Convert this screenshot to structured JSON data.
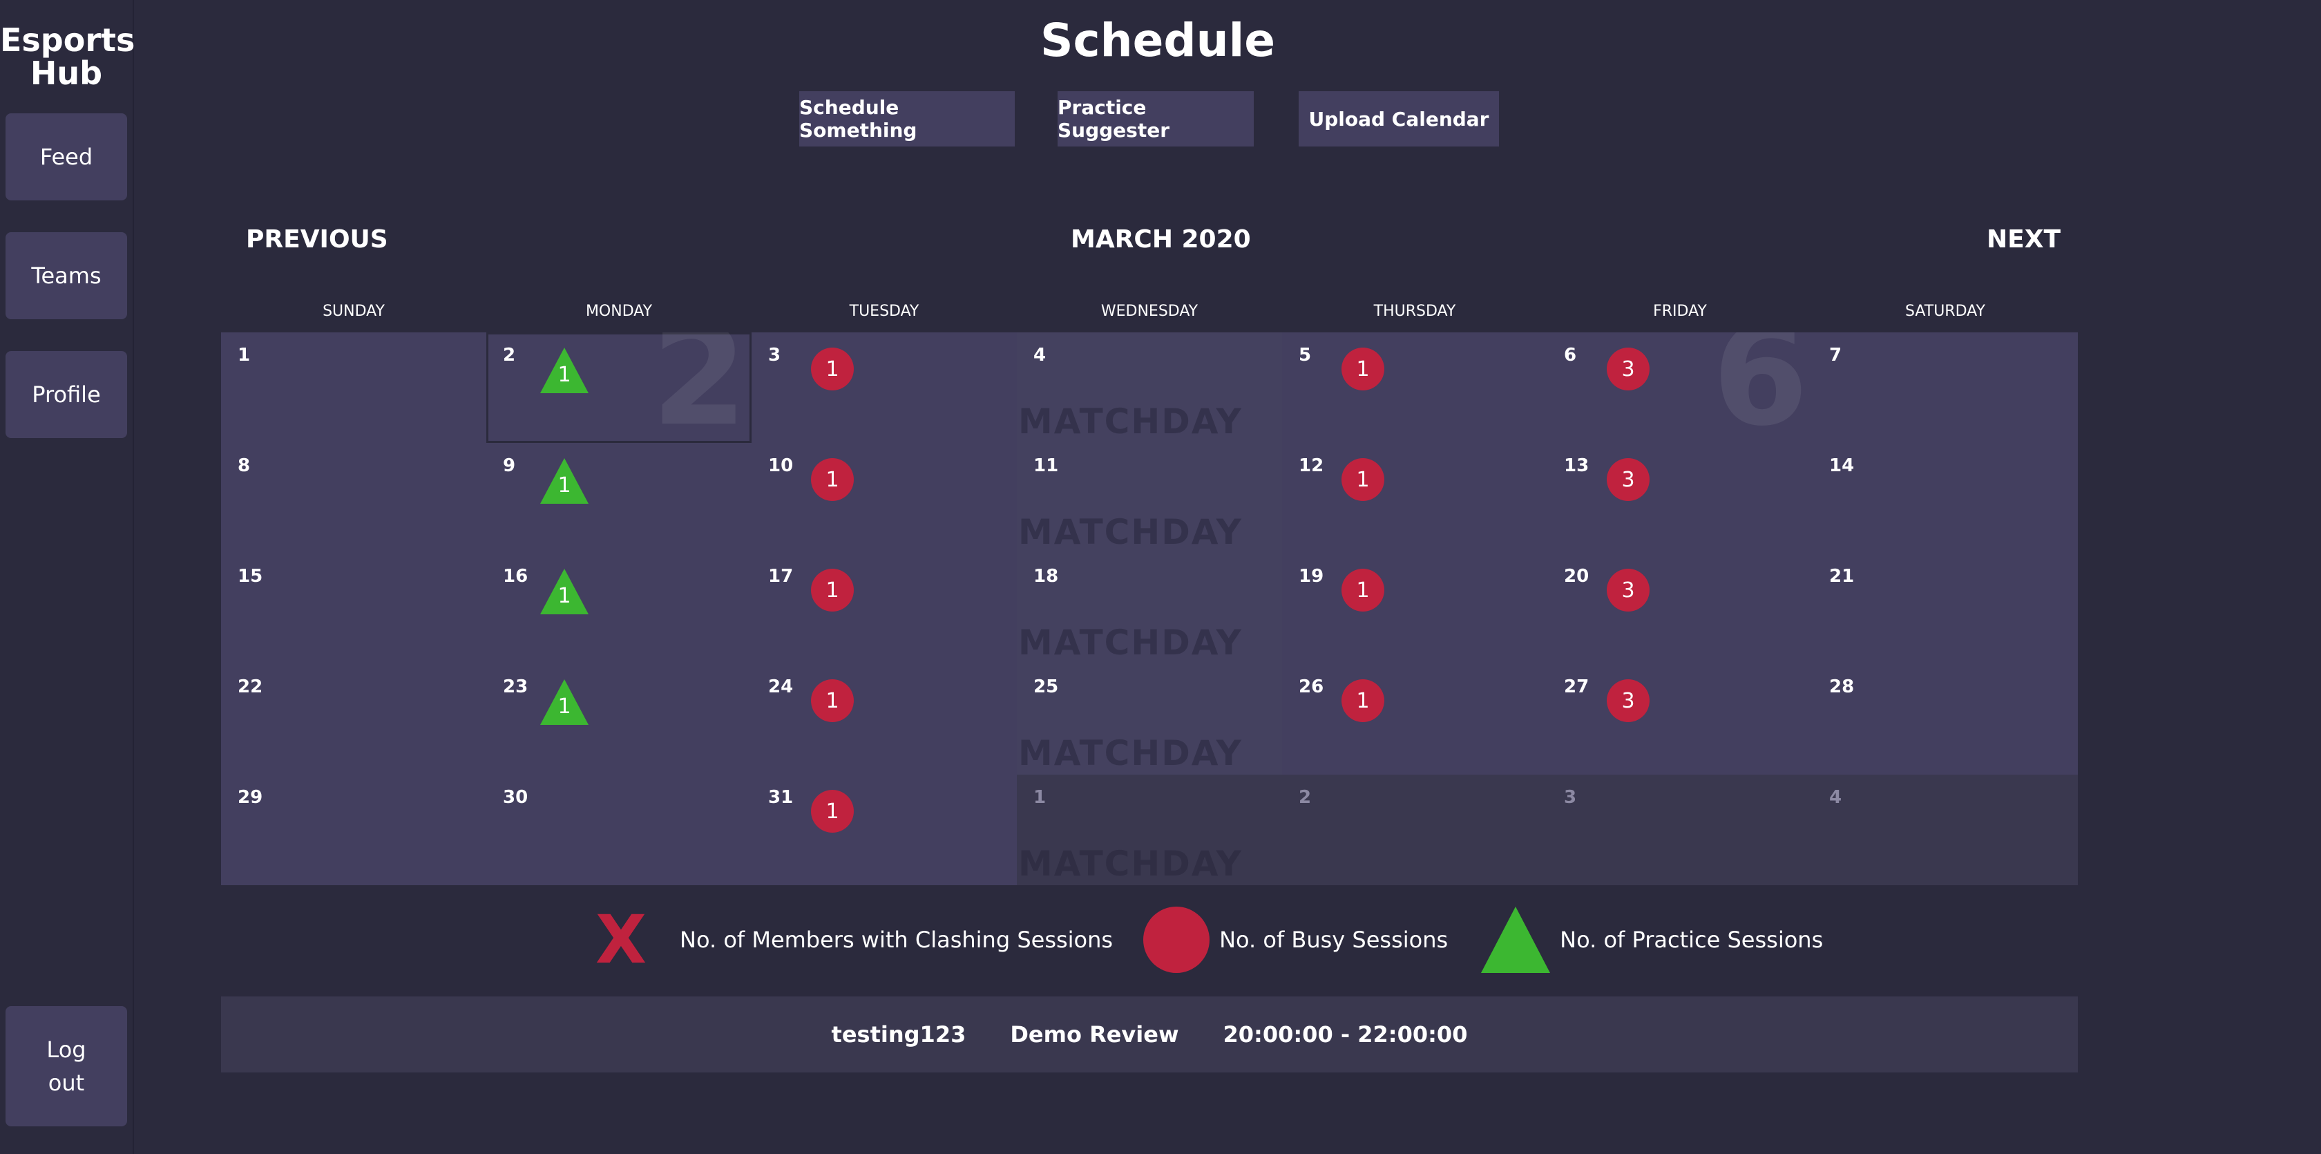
{
  "brand": "Esports Hub",
  "nav": {
    "feed": "Feed",
    "teams": "Teams",
    "profile": "Profile",
    "logout": "Log out"
  },
  "header": {
    "title": "Schedule",
    "buttons": [
      "Schedule Something",
      "Practice Suggester",
      "Upload Calendar"
    ]
  },
  "calendar": {
    "previous": "PREVIOUS",
    "month": "MARCH 2020",
    "next": "NEXT",
    "weekdays": [
      "SUNDAY",
      "MONDAY",
      "TUESDAY",
      "WEDNESDAY",
      "THURSDAY",
      "FRIDAY",
      "SATURDAY"
    ],
    "watermark": "MATCHDAY",
    "days": [
      {
        "n": "1"
      },
      {
        "n": "2",
        "practice": "1",
        "selected": true,
        "big": "2"
      },
      {
        "n": "3",
        "busy": "1"
      },
      {
        "n": "4",
        "matchday": true
      },
      {
        "n": "5",
        "busy": "1"
      },
      {
        "n": "6",
        "busy": "3",
        "big": "6"
      },
      {
        "n": "7"
      },
      {
        "n": "8"
      },
      {
        "n": "9",
        "practice": "1"
      },
      {
        "n": "10",
        "busy": "1"
      },
      {
        "n": "11",
        "matchday": true
      },
      {
        "n": "12",
        "busy": "1"
      },
      {
        "n": "13",
        "busy": "3"
      },
      {
        "n": "14"
      },
      {
        "n": "15"
      },
      {
        "n": "16",
        "practice": "1"
      },
      {
        "n": "17",
        "busy": "1"
      },
      {
        "n": "18",
        "matchday": true
      },
      {
        "n": "19",
        "busy": "1"
      },
      {
        "n": "20",
        "busy": "3"
      },
      {
        "n": "21"
      },
      {
        "n": "22"
      },
      {
        "n": "23",
        "practice": "1"
      },
      {
        "n": "24",
        "busy": "1"
      },
      {
        "n": "25",
        "matchday": true
      },
      {
        "n": "26",
        "busy": "1"
      },
      {
        "n": "27",
        "busy": "3"
      },
      {
        "n": "28"
      },
      {
        "n": "29"
      },
      {
        "n": "30"
      },
      {
        "n": "31",
        "busy": "1"
      },
      {
        "n": "1",
        "grey": true,
        "matchday": true
      },
      {
        "n": "2",
        "grey": true
      },
      {
        "n": "3",
        "grey": true
      },
      {
        "n": "4",
        "grey": true
      }
    ]
  },
  "legend": {
    "x_mark": "X",
    "clashing": "No. of Members with Clashing Sessions",
    "busy": "No. of Busy Sessions",
    "practice": "No. of Practice Sessions"
  },
  "event": {
    "team": "testing123",
    "title": "Demo Review",
    "time": "20:00:00 - 22:00:00"
  },
  "colors": {
    "background": "#2b2a3d",
    "panel": "#433f5f",
    "busy": "#c0223e",
    "practice": "#3cb731"
  }
}
